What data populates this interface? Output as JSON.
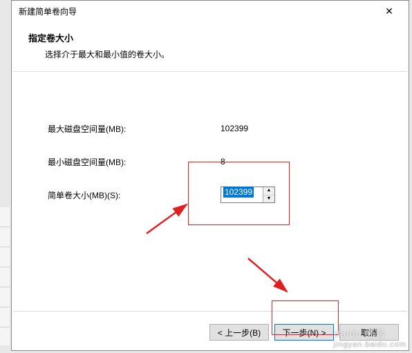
{
  "title": "新建简单卷向导",
  "close_glyph": "✕",
  "header": {
    "title": "指定卷大小",
    "desc": "选择介于最大和最小值的卷大小。"
  },
  "fields": {
    "max_label": "最大磁盘空间量(MB):",
    "max_value": "102399",
    "min_label": "最小磁盘空间量(MB):",
    "min_value": "8",
    "size_label": "简单卷大小(MB)(S):",
    "size_value": "102399"
  },
  "buttons": {
    "back": "< 上一步(B)",
    "next": "下一步(N) >",
    "cancel": "取消"
  },
  "watermark": {
    "main": "Baidu 经验",
    "sub": "jingyan.baidu.com"
  }
}
